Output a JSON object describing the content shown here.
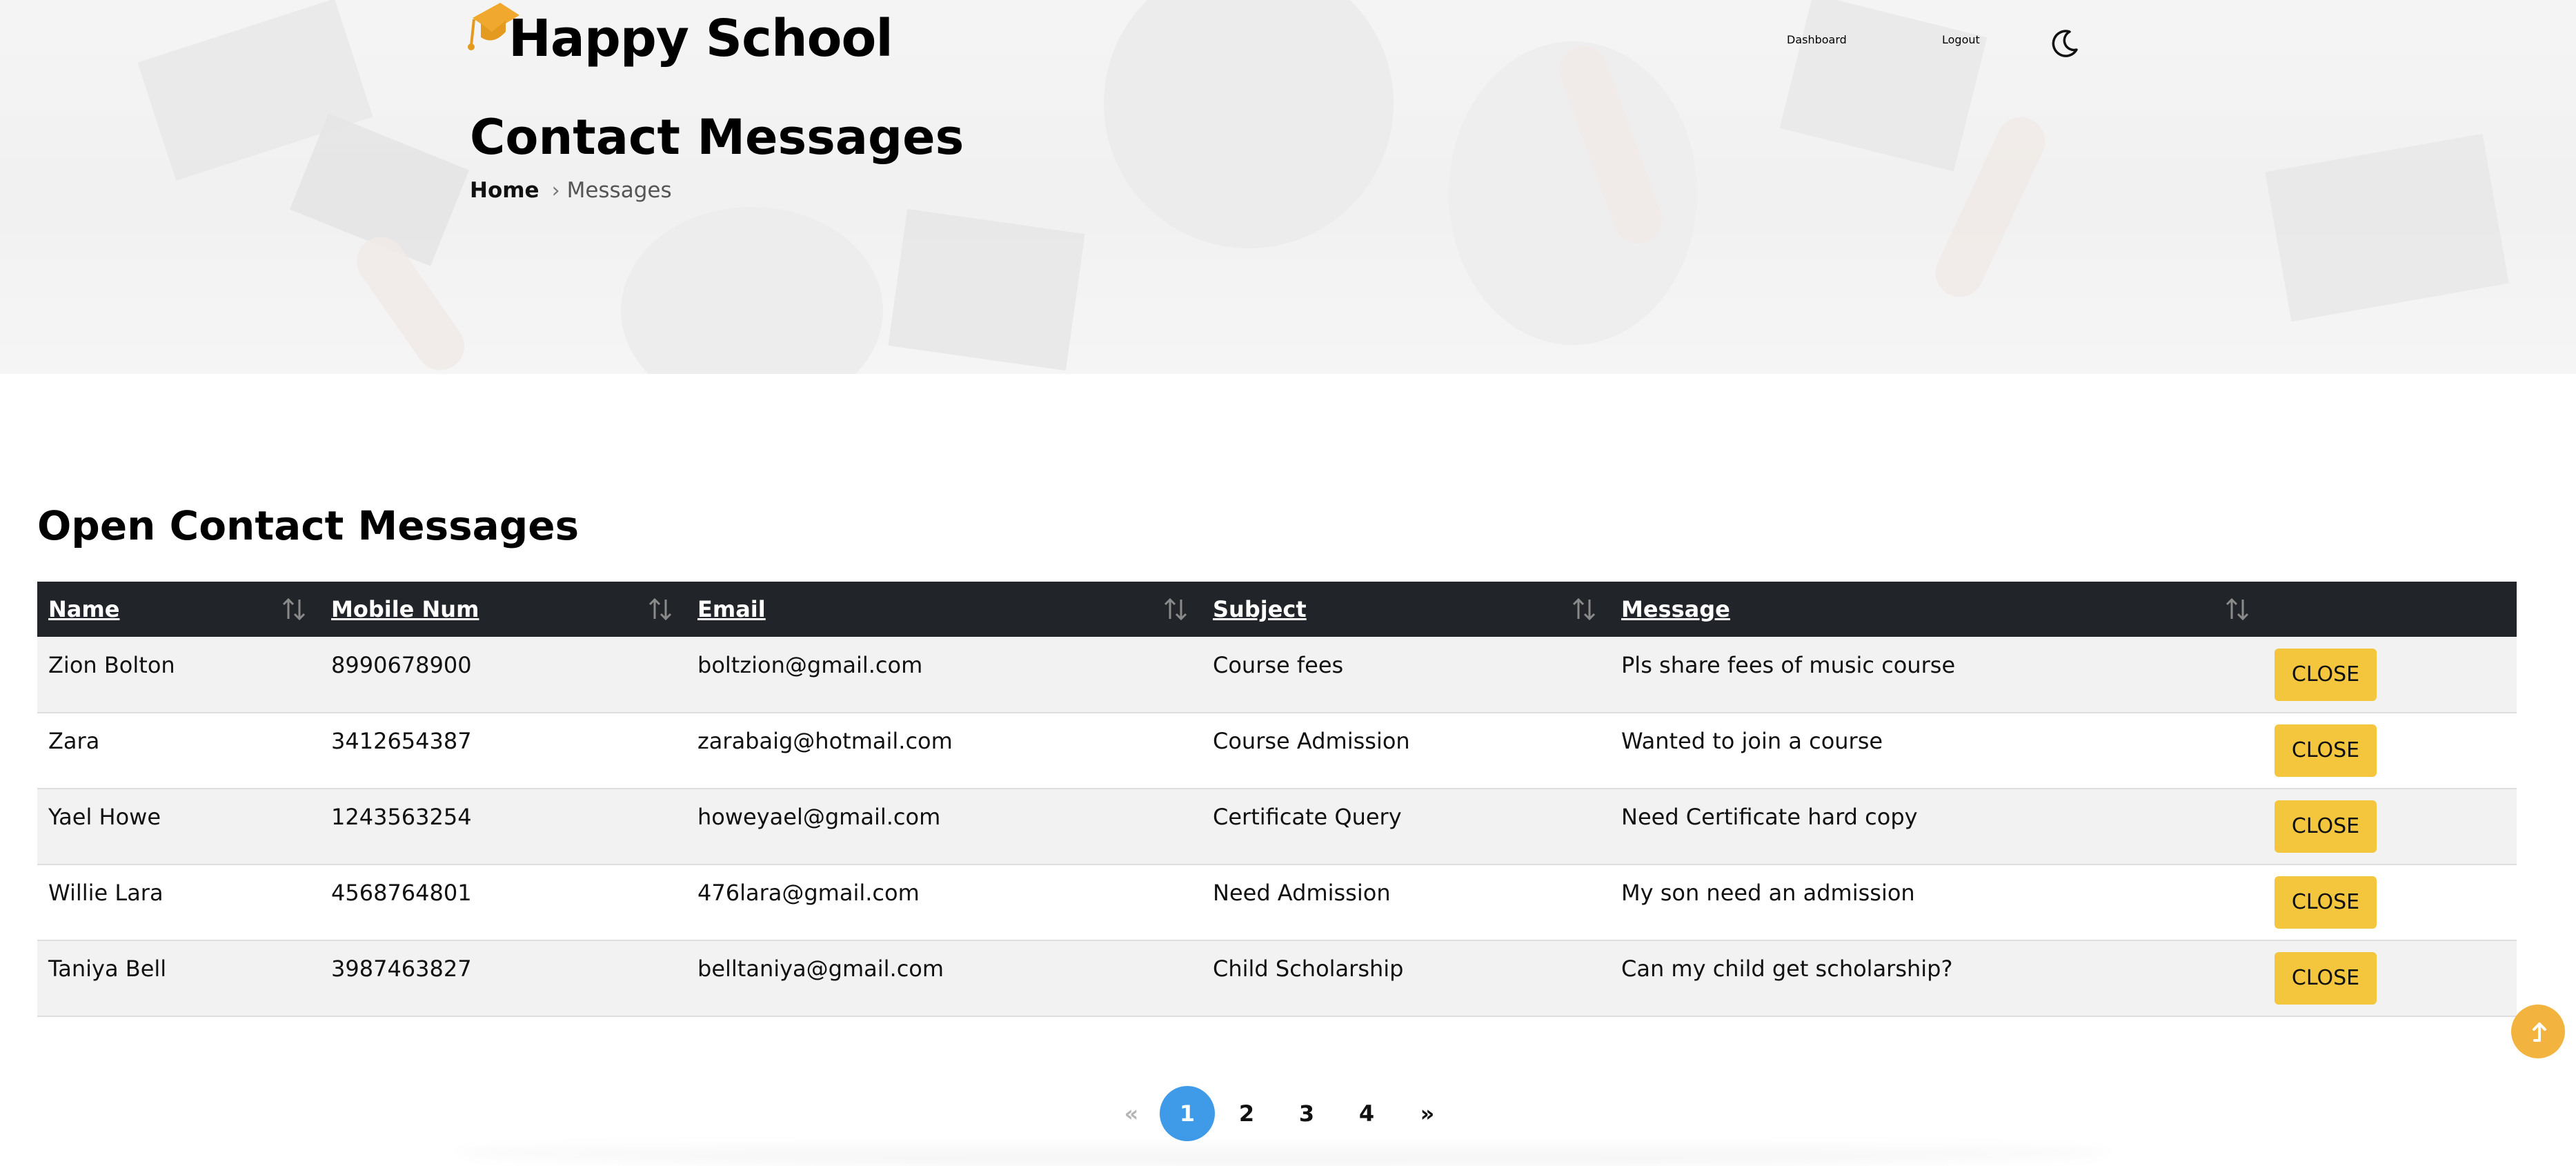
{
  "brand": {
    "name": "Happy School",
    "icon": "graduation-cap-icon"
  },
  "nav": {
    "dashboard": "Dashboard",
    "logout": "Logout",
    "theme_icon": "moon-icon"
  },
  "page": {
    "title": "Contact Messages",
    "breadcrumb": {
      "home": "Home",
      "separator": "›",
      "current": "Messages"
    }
  },
  "section_title": "Open Contact Messages",
  "table": {
    "columns": [
      "Name",
      "Mobile Num",
      "Email",
      "Subject",
      "Message"
    ],
    "rows": [
      {
        "name": "Zion Bolton",
        "mobile": "8990678900",
        "email": "boltzion@gmail.com",
        "subject": "Course fees",
        "message": "Pls share fees of music course",
        "action": "CLOSE"
      },
      {
        "name": "Zara",
        "mobile": "3412654387",
        "email": "zarabaig@hotmail.com",
        "subject": "Course Admission",
        "message": "Wanted to join a course",
        "action": "CLOSE"
      },
      {
        "name": "Yael Howe",
        "mobile": "1243563254",
        "email": "howeyael@gmail.com",
        "subject": "Certificate Query",
        "message": "Need Certificate hard copy",
        "action": "CLOSE"
      },
      {
        "name": "Willie Lara",
        "mobile": "4568764801",
        "email": "476lara@gmail.com",
        "subject": "Need Admission",
        "message": "My son need an admission",
        "action": "CLOSE"
      },
      {
        "name": "Taniya Bell",
        "mobile": "3987463827",
        "email": "belltaniya@gmail.com",
        "subject": "Child Scholarship",
        "message": "Can my child get scholarship?",
        "action": "CLOSE"
      }
    ]
  },
  "pagination": {
    "first": "«",
    "pages": [
      "1",
      "2",
      "3",
      "4"
    ],
    "active": "1",
    "last": "»"
  },
  "colors": {
    "accent": "#f4c63d",
    "header_bg": "#212529",
    "active_page": "#3f9ae8",
    "scroll_top": "#f3b33f"
  }
}
